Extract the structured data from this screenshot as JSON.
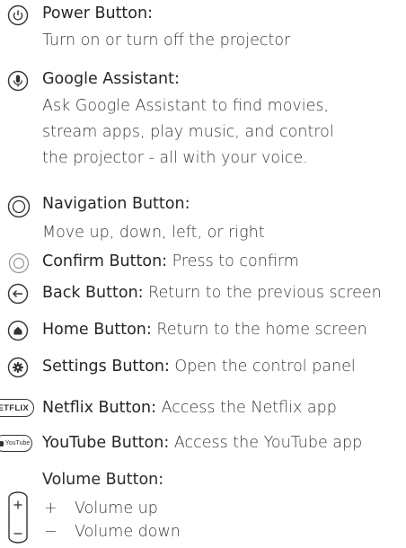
{
  "items": {
    "power": {
      "icon": "power-icon",
      "title": "Power Button:",
      "desc": "Turn on or turn off the projector"
    },
    "assistant": {
      "icon": "microphone-icon",
      "title": "Google Assistant:",
      "desc_lines": [
        "Ask Google Assistant to find movies,",
        "stream apps, play music, and control",
        "the projector - all with your voice."
      ]
    },
    "navigation": {
      "icon": "navigation-ring-icon",
      "title": "Navigation Button:",
      "desc": "Move up, down, left, or right"
    },
    "confirm": {
      "icon": "confirm-ring-icon",
      "title": "Confirm Button:",
      "desc": " Press to confirm"
    },
    "back": {
      "icon": "back-arrow-icon",
      "title": "Back Button:",
      "desc": " Return to the previous screen"
    },
    "home": {
      "icon": "home-icon",
      "title": "Home Button:",
      "desc": " Return to the home screen"
    },
    "settings": {
      "icon": "gear-icon",
      "title": "Settings Button:",
      "desc": " Open the control panel"
    },
    "netflix": {
      "icon": "netflix-badge-icon",
      "badge": "NETFLIX",
      "title": "Netflix Button:",
      "desc": " Access the Netflix app"
    },
    "youtube": {
      "icon": "youtube-badge-icon",
      "badge": "YouTube",
      "title": "YouTube Button:",
      "desc": " Access the YouTube app"
    },
    "volume": {
      "icon": "volume-rocker-icon",
      "title": "Volume Button:",
      "up_symbol": "+",
      "up": "Volume up",
      "down_symbol": "−",
      "down": "Volume down"
    }
  }
}
